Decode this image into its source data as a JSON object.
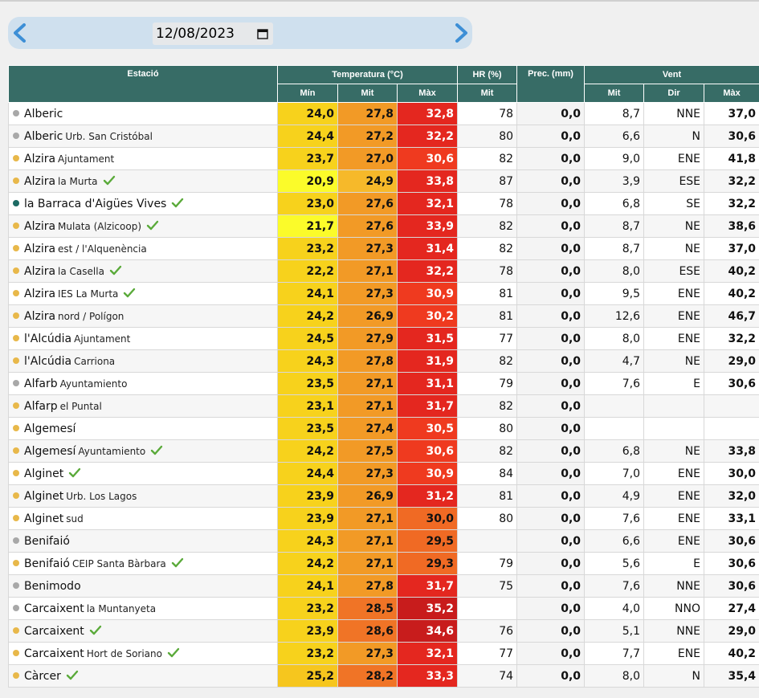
{
  "date": {
    "value": "12/08/2023",
    "prev_icon": "chevron-left-icon",
    "next_icon": "chevron-right-icon",
    "calendar_icon": "calendar-icon"
  },
  "table": {
    "headers": {
      "station": "Estació",
      "temperature": "Temperatura (°C)",
      "humidity": "HR (%)",
      "precipitation": "Prec. (mm)",
      "wind": "Vent",
      "temp_min": "Mín",
      "temp_avg": "Mit",
      "temp_max": "Màx",
      "hr_avg": "Mit",
      "wind_avg": "Mit",
      "wind_dir": "Dir",
      "wind_max": "Màx"
    },
    "colors": {
      "header_bg": "#376c66",
      "dot_gray": "#a8a8a8",
      "dot_yellow": "#e8b84a",
      "dot_teal": "#1d6b64",
      "check": "#5aaa3a"
    },
    "rows": [
      {
        "name": "Alberic",
        "sub": "",
        "dot": "gray",
        "check": false,
        "min": "24,0",
        "avg": "27,8",
        "max": "32,8",
        "hr": "78",
        "prec": "0,0",
        "wavg": "8,7",
        "wdir": "NNE",
        "wmax": "37,0",
        "cmin": "#f7d21c",
        "cavg": "#f29a26",
        "cmax": "#e4271f"
      },
      {
        "name": "Alberic",
        "sub": "Urb. San Cristóbal",
        "dot": "gray",
        "check": false,
        "min": "24,4",
        "avg": "27,2",
        "max": "32,2",
        "hr": "80",
        "prec": "0,0",
        "wavg": "6,6",
        "wdir": "N",
        "wmax": "30,6",
        "cmin": "#f7d21c",
        "cavg": "#f29a26",
        "cmax": "#e4271f"
      },
      {
        "name": "Alzira",
        "sub": "Ajuntament",
        "dot": "yellow",
        "check": false,
        "min": "23,7",
        "avg": "27,0",
        "max": "30,6",
        "hr": "82",
        "prec": "0,0",
        "wavg": "9,0",
        "wdir": "ENE",
        "wmax": "41,8",
        "cmin": "#f7d21c",
        "cavg": "#f29a26",
        "cmax": "#ef3a1f"
      },
      {
        "name": "Alzira",
        "sub": "la Murta",
        "dot": "yellow",
        "check": true,
        "min": "20,9",
        "avg": "24,9",
        "max": "33,8",
        "hr": "87",
        "prec": "0,0",
        "wavg": "3,9",
        "wdir": "ESE",
        "wmax": "32,2",
        "cmin": "#fbfb2a",
        "cavg": "#f6b92a",
        "cmax": "#e4271f"
      },
      {
        "name": "la Barraca d'Aigües Vives",
        "sub": "",
        "dot": "teal",
        "check": true,
        "min": "23,0",
        "avg": "27,6",
        "max": "32,1",
        "hr": "78",
        "prec": "0,0",
        "wavg": "6,8",
        "wdir": "SE",
        "wmax": "32,2",
        "cmin": "#f7d21c",
        "cavg": "#f29a26",
        "cmax": "#e4271f"
      },
      {
        "name": "Alzira",
        "sub": "Mulata (Alzicoop)",
        "dot": "yellow",
        "check": true,
        "min": "21,7",
        "avg": "27,6",
        "max": "33,9",
        "hr": "82",
        "prec": "0,0",
        "wavg": "8,7",
        "wdir": "NE",
        "wmax": "38,6",
        "cmin": "#fbfb2a",
        "cavg": "#f29a26",
        "cmax": "#e4271f"
      },
      {
        "name": "Alzira",
        "sub": "est / l'Alquenència",
        "dot": "yellow",
        "check": false,
        "min": "23,2",
        "avg": "27,3",
        "max": "31,4",
        "hr": "82",
        "prec": "0,0",
        "wavg": "8,7",
        "wdir": "NE",
        "wmax": "37,0",
        "cmin": "#f7d21c",
        "cavg": "#f29a26",
        "cmax": "#e4271f"
      },
      {
        "name": "Alzira",
        "sub": "la Casella",
        "dot": "yellow",
        "check": true,
        "min": "22,2",
        "avg": "27,1",
        "max": "32,2",
        "hr": "78",
        "prec": "0,0",
        "wavg": "8,0",
        "wdir": "ESE",
        "wmax": "40,2",
        "cmin": "#f7d21c",
        "cavg": "#f29a26",
        "cmax": "#e4271f"
      },
      {
        "name": "Alzira",
        "sub": "IES La Murta",
        "dot": "yellow",
        "check": true,
        "min": "24,1",
        "avg": "27,3",
        "max": "30,9",
        "hr": "81",
        "prec": "0,0",
        "wavg": "9,5",
        "wdir": "ENE",
        "wmax": "40,2",
        "cmin": "#f7d21c",
        "cavg": "#f29a26",
        "cmax": "#ef3a1f"
      },
      {
        "name": "Alzira",
        "sub": "nord / Polígon",
        "dot": "yellow",
        "check": false,
        "min": "24,2",
        "avg": "26,9",
        "max": "30,2",
        "hr": "81",
        "prec": "0,0",
        "wavg": "12,6",
        "wdir": "ENE",
        "wmax": "46,7",
        "cmin": "#f7d21c",
        "cavg": "#f29a26",
        "cmax": "#ef3a1f"
      },
      {
        "name": "l'Alcúdia",
        "sub": "Ajuntament",
        "dot": "yellow",
        "check": false,
        "min": "24,5",
        "avg": "27,9",
        "max": "31,5",
        "hr": "77",
        "prec": "0,0",
        "wavg": "8,0",
        "wdir": "ENE",
        "wmax": "32,2",
        "cmin": "#f7d21c",
        "cavg": "#f29a26",
        "cmax": "#e4271f"
      },
      {
        "name": "l'Alcúdia",
        "sub": "Carriona",
        "dot": "yellow",
        "check": false,
        "min": "24,3",
        "avg": "27,8",
        "max": "31,9",
        "hr": "82",
        "prec": "0,0",
        "wavg": "4,7",
        "wdir": "NE",
        "wmax": "29,0",
        "cmin": "#f7d21c",
        "cavg": "#f29a26",
        "cmax": "#e4271f"
      },
      {
        "name": "Alfarb",
        "sub": "Ayuntamiento",
        "dot": "gray",
        "check": false,
        "min": "23,5",
        "avg": "27,1",
        "max": "31,1",
        "hr": "79",
        "prec": "0,0",
        "wavg": "7,6",
        "wdir": "E",
        "wmax": "30,6",
        "cmin": "#f7d21c",
        "cavg": "#f29a26",
        "cmax": "#e4271f"
      },
      {
        "name": "Alfarp",
        "sub": "el Puntal",
        "dot": "yellow",
        "check": false,
        "min": "23,1",
        "avg": "27,1",
        "max": "31,7",
        "hr": "82",
        "prec": "0,0",
        "wavg": "",
        "wdir": "",
        "wmax": "",
        "cmin": "#f7d21c",
        "cavg": "#f29a26",
        "cmax": "#e4271f"
      },
      {
        "name": "Algemesí",
        "sub": "",
        "dot": "yellow",
        "check": false,
        "min": "23,5",
        "avg": "27,4",
        "max": "30,5",
        "hr": "80",
        "prec": "0,0",
        "wavg": "",
        "wdir": "",
        "wmax": "",
        "cmin": "#f7d21c",
        "cavg": "#f29a26",
        "cmax": "#ef3a1f"
      },
      {
        "name": "Algemesí",
        "sub": "Ayuntamiento",
        "dot": "yellow",
        "check": true,
        "min": "24,2",
        "avg": "27,5",
        "max": "30,6",
        "hr": "82",
        "prec": "0,0",
        "wavg": "6,8",
        "wdir": "NE",
        "wmax": "33,8",
        "cmin": "#f7d21c",
        "cavg": "#f29a26",
        "cmax": "#ef3a1f"
      },
      {
        "name": "Alginet",
        "sub": "",
        "dot": "yellow",
        "check": true,
        "min": "24,4",
        "avg": "27,3",
        "max": "30,9",
        "hr": "84",
        "prec": "0,0",
        "wavg": "7,0",
        "wdir": "ENE",
        "wmax": "30,0",
        "cmin": "#f7d21c",
        "cavg": "#f29a26",
        "cmax": "#ef3a1f"
      },
      {
        "name": "Alginet",
        "sub": "Urb. Los Lagos",
        "dot": "yellow",
        "check": false,
        "min": "23,9",
        "avg": "26,9",
        "max": "31,2",
        "hr": "81",
        "prec": "0,0",
        "wavg": "4,9",
        "wdir": "ENE",
        "wmax": "32,0",
        "cmin": "#f7d21c",
        "cavg": "#f29a26",
        "cmax": "#e4271f"
      },
      {
        "name": "Alginet",
        "sub": "sud",
        "dot": "yellow",
        "check": false,
        "min": "23,9",
        "avg": "27,1",
        "max": "30,0",
        "hr": "80",
        "prec": "0,0",
        "wavg": "7,6",
        "wdir": "ENE",
        "wmax": "33,1",
        "cmin": "#f7d21c",
        "cavg": "#f29a26",
        "cmax": "#f06a24"
      },
      {
        "name": "Benifaió",
        "sub": "",
        "dot": "gray",
        "check": false,
        "min": "24,3",
        "avg": "27,1",
        "max": "29,5",
        "hr": "",
        "prec": "0,0",
        "wavg": "6,6",
        "wdir": "ENE",
        "wmax": "30,6",
        "cmin": "#f7d21c",
        "cavg": "#f29a26",
        "cmax": "#f06a24"
      },
      {
        "name": "Benifaió",
        "sub": "CEIP Santa Bàrbara",
        "dot": "yellow",
        "check": true,
        "min": "24,2",
        "avg": "27,1",
        "max": "29,3",
        "hr": "79",
        "prec": "0,0",
        "wavg": "5,6",
        "wdir": "E",
        "wmax": "30,6",
        "cmin": "#f7d21c",
        "cavg": "#f29a26",
        "cmax": "#f06a24"
      },
      {
        "name": "Benimodo",
        "sub": "",
        "dot": "gray",
        "check": false,
        "min": "24,1",
        "avg": "27,8",
        "max": "31,7",
        "hr": "75",
        "prec": "0,0",
        "wavg": "7,6",
        "wdir": "NNE",
        "wmax": "30,6",
        "cmin": "#f7d21c",
        "cavg": "#f29a26",
        "cmax": "#e4271f"
      },
      {
        "name": "Carcaixent",
        "sub": "la Muntanyeta",
        "dot": "gray",
        "check": false,
        "min": "23,2",
        "avg": "28,5",
        "max": "35,2",
        "hr": "",
        "prec": "0,0",
        "wavg": "4,0",
        "wdir": "NNO",
        "wmax": "27,4",
        "cmin": "#f7d21c",
        "cavg": "#f07426",
        "cmax": "#c81c1c"
      },
      {
        "name": "Carcaixent",
        "sub": "",
        "dot": "yellow",
        "check": true,
        "min": "23,9",
        "avg": "28,6",
        "max": "34,6",
        "hr": "76",
        "prec": "0,0",
        "wavg": "5,1",
        "wdir": "NNE",
        "wmax": "29,0",
        "cmin": "#f7d21c",
        "cavg": "#f07426",
        "cmax": "#c81c1c"
      },
      {
        "name": "Carcaixent",
        "sub": "Hort de Soriano",
        "dot": "yellow",
        "check": true,
        "min": "23,2",
        "avg": "27,3",
        "max": "32,1",
        "hr": "77",
        "prec": "0,0",
        "wavg": "7,7",
        "wdir": "ENE",
        "wmax": "40,2",
        "cmin": "#f7d21c",
        "cavg": "#f29a26",
        "cmax": "#e4271f"
      },
      {
        "name": "Càrcer",
        "sub": "",
        "dot": "yellow",
        "check": true,
        "min": "25,2",
        "avg": "28,2",
        "max": "33,3",
        "hr": "74",
        "prec": "0,0",
        "wavg": "8,0",
        "wdir": "N",
        "wmax": "35,4",
        "cmin": "#f6c61e",
        "cavg": "#f07426",
        "cmax": "#e4271f"
      }
    ]
  }
}
